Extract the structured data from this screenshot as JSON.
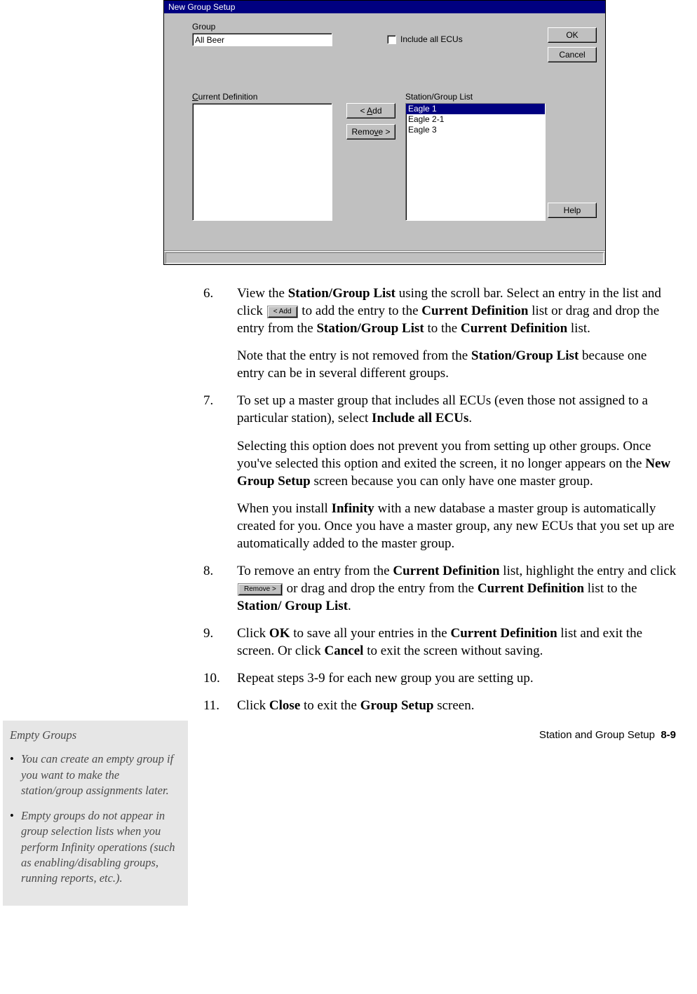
{
  "dialog": {
    "title": "New Group Setup",
    "group_label": "Group",
    "group_value": "All Beer",
    "include_all_label": "Include all ECUs",
    "ok": "OK",
    "cancel": "Cancel",
    "help": "Help",
    "current_def_label": "Current Definition",
    "sgl_label": "Station/Group List",
    "add_label": "< Add",
    "remove_label": "Remove >",
    "sgl_items": [
      "Eagle 1",
      "Eagle 2-1",
      "Eagle 3"
    ]
  },
  "steps": {
    "s6_num": "6.",
    "s6a_pre": "View the ",
    "s6a_b1": "Station/Group List",
    "s6a_mid1": " using the scroll bar. Select an entry in the list and click ",
    "s6a_btn": "< Add",
    "s6a_mid2": " to add the entry to the ",
    "s6a_b2": "Current Definition",
    "s6a_mid3": " list or drag and drop the entry from the ",
    "s6a_b3": "Station/Group List",
    "s6a_mid4": " to the ",
    "s6a_b4": "Current Definition",
    "s6a_end": " list.",
    "s6b_pre": "Note that the entry is not removed from the ",
    "s6b_b1": "Station/Group List",
    "s6b_end": " because one entry can be in several different groups.",
    "s7_num": "7.",
    "s7a_pre": "To set up a master group that includes all ECUs (even those not assigned to a particular station), select ",
    "s7a_b1": "Include all ECUs",
    "s7a_end": ".",
    "s7b_pre": "Selecting this option does not prevent you from setting up other groups. Once you've selected this option and exited the screen, it no longer appears on the ",
    "s7b_b1": "New Group Setup",
    "s7b_end": " screen because you can only have one master group.",
    "s7c_pre": "When you install ",
    "s7c_b1": "Infinity",
    "s7c_end": " with a new database a master group is automatically created for you. Once you have a master group, any new ECUs that you set up are automatically added to the master group.",
    "s8_num": "8.",
    "s8_pre": "To remove an entry from the ",
    "s8_b1": "Current Definition",
    "s8_mid1": " list, highlight the entry and click ",
    "s8_btn": "Remove >",
    "s8_mid2": " or drag and drop the entry from the ",
    "s8_b2": "Current Definition",
    "s8_mid3": " list to the ",
    "s8_b3": "Station/ Group List",
    "s8_end": ".",
    "s9_num": "9.",
    "s9_pre": "Click ",
    "s9_b1": "OK",
    "s9_mid1": " to save all your entries in the ",
    "s9_b2": "Current Definition",
    "s9_mid2": " list and exit the screen. Or click ",
    "s9_b3": "Cancel",
    "s9_end": " to exit the screen without saving.",
    "s10_num": "10.",
    "s10_text": "Repeat steps 3-9 for each new group you are setting up.",
    "s11_num": "11.",
    "s11_pre": "Click ",
    "s11_b1": "Close",
    "s11_mid": " to exit the ",
    "s11_b2": "Group Setup",
    "s11_end": " screen."
  },
  "sidebar": {
    "title": "Empty Groups",
    "item1": "You can create an empty group if you want to make the station/group assignments later.",
    "item2": "Empty groups do not appear in group selection lists when you perform Infinity operations (such as enabling/disabling groups, running reports, etc.)."
  },
  "footer": {
    "section": "Station and Group Setup",
    "page": "8-9"
  }
}
